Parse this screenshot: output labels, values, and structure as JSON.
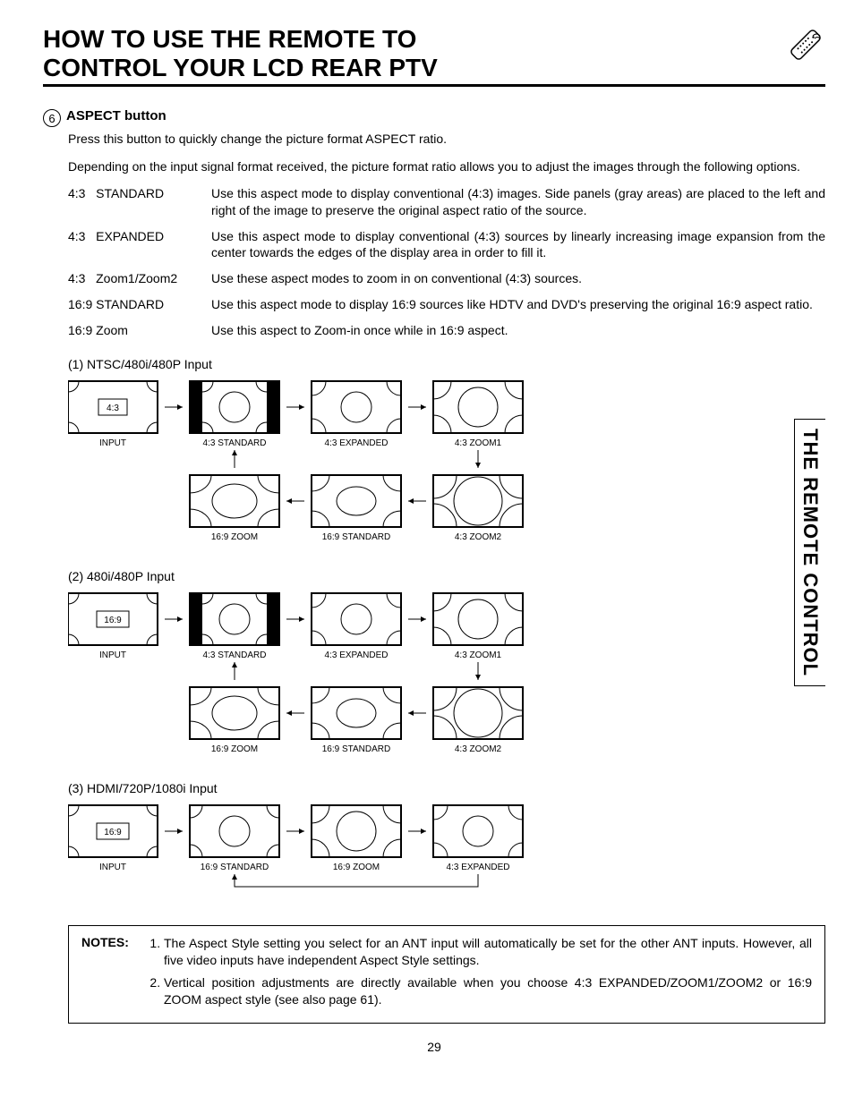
{
  "page_title_line1": "HOW TO USE THE REMOTE TO",
  "page_title_line2": "CONTROL YOUR LCD REAR PTV",
  "side_tab": "THE REMOTE CONTROL",
  "section_number": "6",
  "section_title": "ASPECT button",
  "intro1": "Press this button to quickly change the picture format ASPECT ratio.",
  "intro2": "Depending on the input signal format received, the picture format ratio allows you to adjust the images through the following options.",
  "modes": [
    {
      "label": "4:3   STANDARD",
      "desc": "Use this aspect mode to display conventional (4:3) images.  Side panels (gray areas) are placed to the left and right of the image to preserve the original aspect ratio of the source."
    },
    {
      "label": "4:3   EXPANDED",
      "desc": "Use this aspect mode to display conventional (4:3) sources by linearly increasing image expansion from the center towards the edges of the display area in order to fill it."
    },
    {
      "label": "4:3   Zoom1/Zoom2",
      "desc": "Use these aspect modes to zoom in on conventional (4:3) sources."
    },
    {
      "label": "16:9 STANDARD",
      "desc": "Use this aspect mode to display 16:9 sources like HDTV and DVD's preserving the original 16:9 aspect ratio."
    },
    {
      "label": "16:9 Zoom",
      "desc": "Use this aspect to Zoom-in once while in 16:9 aspect."
    }
  ],
  "diag1_heading": "(1)    NTSC/480i/480P Input",
  "diag2_heading": "(2)    480i/480P Input",
  "diag3_heading": "(3)    HDMI/720P/1080i Input",
  "d1": {
    "input_badge": "4:3",
    "labels": [
      "INPUT",
      "4:3 STANDARD",
      "4:3 EXPANDED",
      "4:3 ZOOM1",
      "16:9 ZOOM",
      "16:9 STANDARD",
      "4:3 ZOOM2"
    ]
  },
  "d2": {
    "input_badge": "16:9",
    "labels": [
      "INPUT",
      "4:3 STANDARD",
      "4:3 EXPANDED",
      "4:3 ZOOM1",
      "16:9 ZOOM",
      "16:9 STANDARD",
      "4:3 ZOOM2"
    ]
  },
  "d3": {
    "input_badge": "16:9",
    "labels": [
      "INPUT",
      "16:9 STANDARD",
      "16:9 ZOOM",
      "4:3 EXPANDED"
    ]
  },
  "notes_label": "NOTES:",
  "notes": [
    "The Aspect Style setting you select for an ANT input will automatically be set for the other ANT inputs.  However, all five video inputs have independent Aspect Style settings.",
    "Vertical position adjustments are directly available when you choose 4:3 EXPANDED/ZOOM1/ZOOM2 or 16:9 ZOOM aspect style (see also page 61)."
  ],
  "page_number": "29"
}
